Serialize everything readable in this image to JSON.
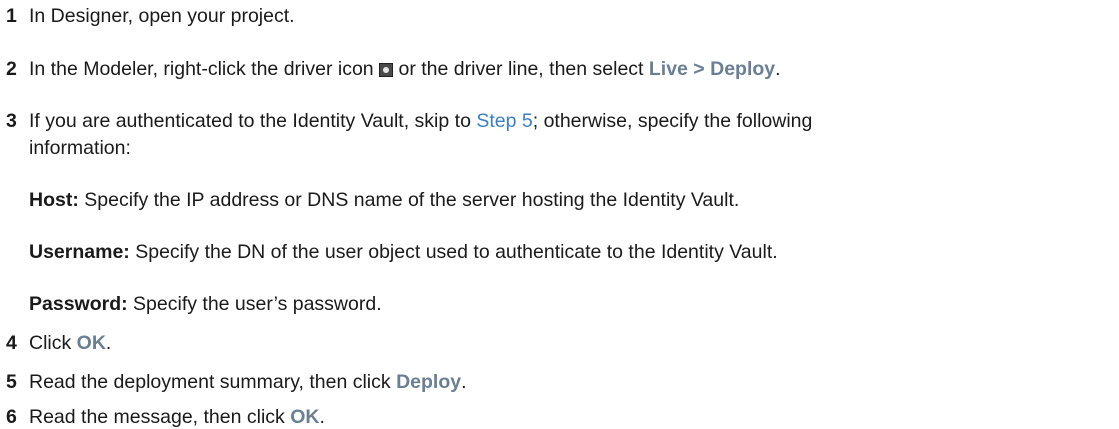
{
  "steps": [
    {
      "num": "1",
      "text": "In Designer, open your project."
    },
    {
      "num": "2",
      "pre": "In the Modeler, right-click the driver icon",
      "icon": "driver-icon",
      "mid": " or the driver line, then select ",
      "ui": "Live > Deploy",
      "post": "."
    },
    {
      "num": "3",
      "pre": "If you are authenticated to the Identity Vault, skip to ",
      "link": "Step 5",
      "post": "; otherwise, specify the following",
      "cont": "information:",
      "fields": [
        {
          "term": "Host:",
          "desc": " Specify the IP address or DNS name of the server hosting the Identity Vault."
        },
        {
          "term": "Username:",
          "desc": " Specify the DN of the user object used to authenticate to the Identity Vault."
        },
        {
          "term": "Password:",
          "desc": " Specify the user’s password."
        }
      ]
    },
    {
      "num": "4",
      "pre": "Click ",
      "ui": "OK",
      "post": "."
    },
    {
      "num": "5",
      "pre": "Read the deployment summary, then click ",
      "ui": "Deploy",
      "post": "."
    },
    {
      "num": "6",
      "pre": "Read the message, then click ",
      "ui": "OK",
      "post": "."
    }
  ],
  "colors": {
    "ui_label": "#6a7f93",
    "link": "#3b7fc4",
    "text": "#1a1a1a"
  }
}
